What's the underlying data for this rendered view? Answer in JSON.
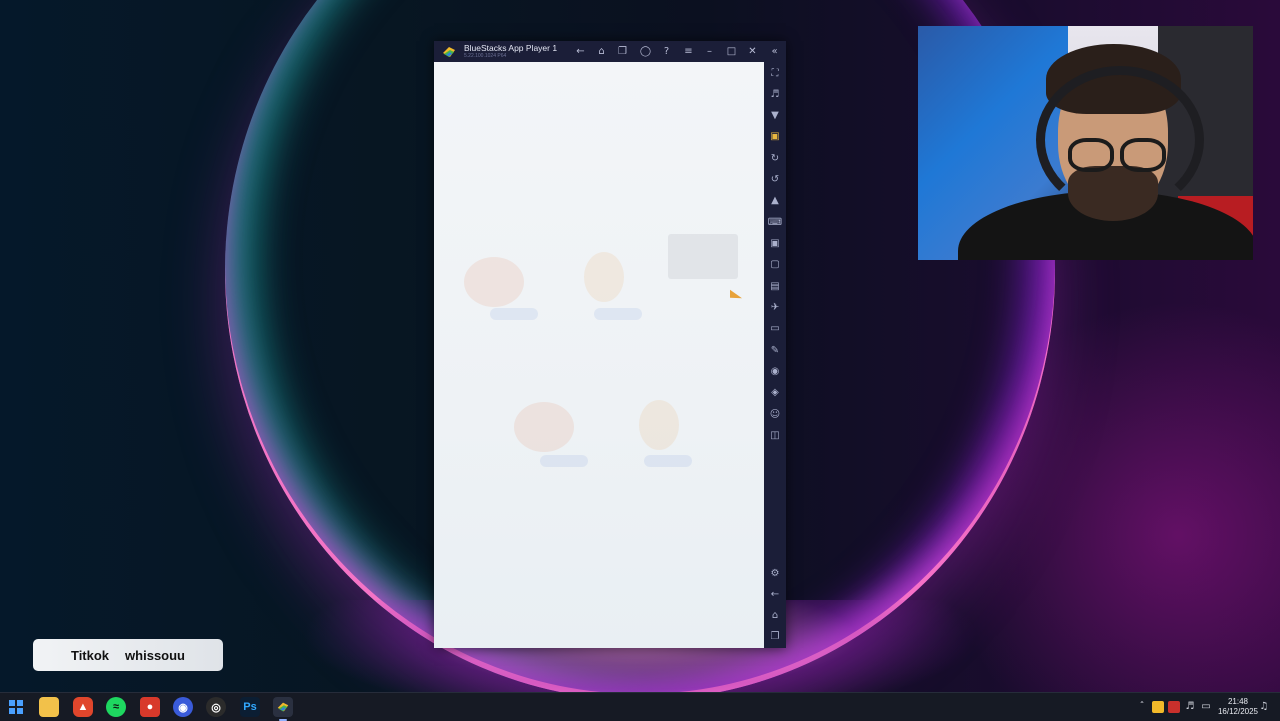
{
  "window": {
    "title": "BlueStacks App Player 1",
    "subtitle": "5.22.100.1024  P64"
  },
  "titlebar_icons": [
    "back-icon",
    "home-icon",
    "multi-instance-icon",
    "account-icon",
    "help-icon",
    "menu-icon",
    "minimize-icon",
    "maximize-icon",
    "close-icon",
    "collapse-sidebar-icon"
  ],
  "sidebar_icons": [
    "fullscreen-icon",
    "volume-icon",
    "media-icon",
    "macro-recorder-icon",
    "rotate-icon",
    "sync-icon",
    "game-controls-icon",
    "keyboard-icon",
    "screenshot-icon",
    "screen-record-icon",
    "gallery-icon",
    "airplane-icon",
    "resize-icon",
    "eco-mode-icon",
    "location-icon",
    "layers-icon",
    "realtime-translate-icon",
    "sidebar-toggle-icon"
  ],
  "sidebar_bottom_icons": [
    "settings-icon",
    "android-back-icon",
    "android-home-icon",
    "recent-apps-icon"
  ],
  "overlay": {
    "label_left": "Titkok",
    "label_right": "whissouu"
  },
  "taskbar": {
    "apps": [
      "windows-start-icon",
      "file-explorer-icon",
      "brave-icon",
      "spotify-icon",
      "app-icon",
      "chrome-icon",
      "obs-icon",
      "photoshop-icon",
      "bluestacks-icon"
    ],
    "photoshop_label": "Ps",
    "tray": {
      "time": "21:48",
      "date": "16/12/2025"
    }
  }
}
